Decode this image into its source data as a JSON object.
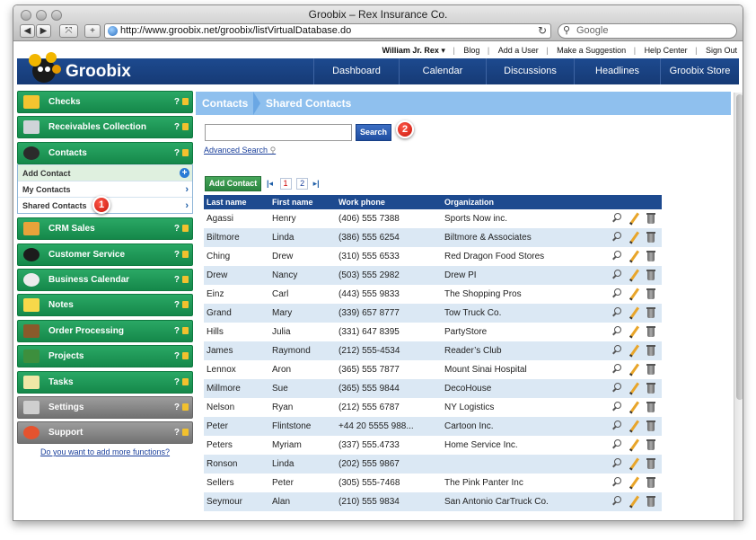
{
  "window": {
    "title": "Groobix – Rex Insurance Co."
  },
  "browser": {
    "url": "http://www.groobix.net/groobix/listVirtualDatabase.do",
    "search_placeholder": "Google",
    "add_label": "+",
    "reload_glyph": "↻",
    "back_glyph": "◀",
    "forward_glyph": "▶"
  },
  "toplinks": {
    "user": "William Jr. Rex ▾",
    "links": [
      "Blog",
      "Add a User",
      "Make a Suggestion",
      "Help Center",
      "Sign Out"
    ]
  },
  "logo": {
    "text": "Groobix"
  },
  "nav": {
    "tabs": [
      "Dashboard",
      "Calendar",
      "Discussions",
      "Headlines",
      "Groobix Store"
    ]
  },
  "sidebar": {
    "items": [
      {
        "label": "Checks",
        "color": "#1f9a57"
      },
      {
        "label": "Receivables Collection",
        "color": "#1f9a57"
      },
      {
        "label": "Contacts",
        "color": "#1f9a57"
      },
      {
        "label": "CRM Sales",
        "color": "#1f9a57"
      },
      {
        "label": "Customer Service",
        "color": "#1f9a57"
      },
      {
        "label": "Business Calendar",
        "color": "#1f9a57"
      },
      {
        "label": "Notes",
        "color": "#1f9a57"
      },
      {
        "label": "Order Processing",
        "color": "#1f9a57"
      },
      {
        "label": "Projects",
        "color": "#1f9a57"
      },
      {
        "label": "Tasks",
        "color": "#1f9a57"
      },
      {
        "label": "Settings",
        "color": "#888888"
      },
      {
        "label": "Support",
        "color": "#888888"
      }
    ],
    "help_glyph": "?",
    "contacts_sub": [
      "Add Contact",
      "My Contacts",
      "Shared Contacts"
    ],
    "more_functions": "Do you want to add more functions?"
  },
  "callouts": [
    "1",
    "2"
  ],
  "breadcrumb": {
    "section": "Contacts",
    "page": "Shared Contacts"
  },
  "search": {
    "button": "Search",
    "advanced": "Advanced Search"
  },
  "list": {
    "add_button": "Add Contact",
    "pages": [
      "1",
      "2"
    ],
    "first_glyph": "|◂",
    "last_glyph": "▸|",
    "columns": [
      "Last name",
      "First name",
      "Work phone",
      "Organization"
    ],
    "rows": [
      [
        "Agassi",
        "Henry",
        "(406) 555 7388",
        "Sports Now inc."
      ],
      [
        "Biltmore",
        "Linda",
        "(386) 555 6254",
        "Biltmore & Associates"
      ],
      [
        "Ching",
        "Drew",
        "(310) 555 6533",
        "Red Dragon Food Stores"
      ],
      [
        "Drew",
        "Nancy",
        "(503) 555 2982",
        "Drew PI"
      ],
      [
        "Einz",
        "Carl",
        "(443) 555 9833",
        "The Shopping Pros"
      ],
      [
        "Grand",
        "Mary",
        "(339) 657 8777",
        "Tow Truck Co."
      ],
      [
        "Hills",
        "Julia",
        "(331) 647 8395",
        "PartyStore"
      ],
      [
        "James",
        "Raymond",
        "(212) 555-4534",
        "Reader’s Club"
      ],
      [
        "Lennox",
        "Aron",
        "(365) 555 7877",
        "Mount Sinai Hospital"
      ],
      [
        "Millmore",
        "Sue",
        "(365) 555 9844",
        "DecoHouse"
      ],
      [
        "Nelson",
        "Ryan",
        "(212) 555 6787",
        "NY Logistics"
      ],
      [
        "Peter",
        "Flintstone",
        "+44 20 5555 988...",
        "Cartoon Inc."
      ],
      [
        "Peters",
        "Myriam",
        "(337) 555.4733",
        "Home Service Inc."
      ],
      [
        "Ronson",
        "Linda",
        "(202) 555 9867",
        ""
      ],
      [
        "Sellers",
        "Peter",
        "(305) 555-7468",
        "The Pink Panter Inc"
      ],
      [
        "Seymour",
        "Alan",
        "(210) 555 9834",
        "San Antonio CarTruck Co."
      ]
    ]
  }
}
